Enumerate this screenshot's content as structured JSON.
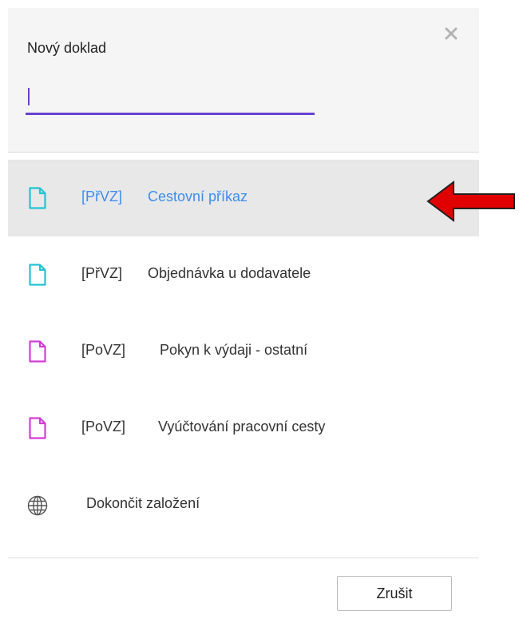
{
  "dialog": {
    "title": "Nový doklad",
    "search_value": "",
    "close_icon": "close-icon"
  },
  "items": [
    {
      "code": "[PřVZ]",
      "label": "Cestovní příkaz",
      "icon": "document-icon",
      "icon_color": "#23c3d3",
      "selected": true
    },
    {
      "code": "[PřVZ]",
      "label": "Objednávka u dodavatele",
      "icon": "document-icon",
      "icon_color": "#23c3d3",
      "selected": false
    },
    {
      "code": "[PoVZ]",
      "label": "Pokyn k výdaji - ostatní",
      "icon": "document-icon",
      "icon_color": "#d23cd8",
      "selected": false
    },
    {
      "code": "[PoVZ]",
      "label": "Vyúčtování pracovní cesty",
      "icon": "document-icon",
      "icon_color": "#d23cd8",
      "selected": false
    },
    {
      "code": "",
      "label": "Dokončit založení",
      "icon": "globe-icon",
      "selected": false
    }
  ],
  "footer": {
    "cancel_label": "Zrušit"
  },
  "colors": {
    "accent": "#6a3fd1",
    "selected_text": "#3d8df0",
    "annotation_arrow": "#e00000"
  }
}
